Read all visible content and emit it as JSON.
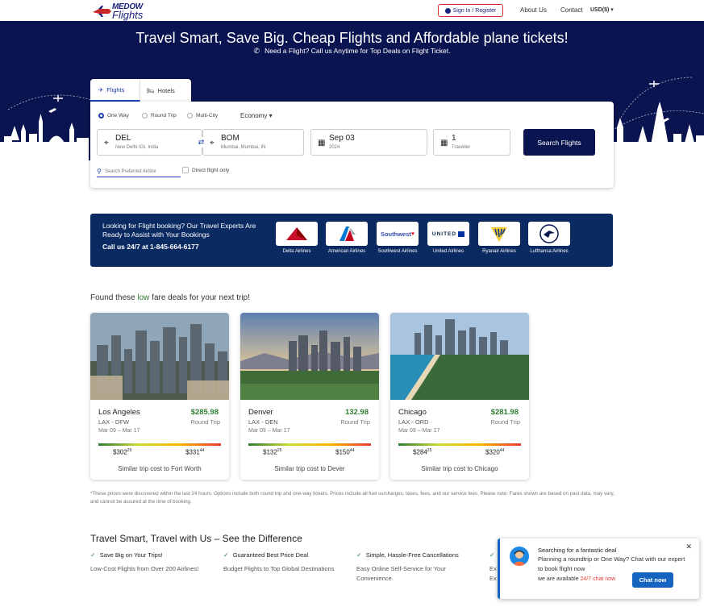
{
  "header": {
    "logo_top": "MEDOW",
    "logo_bottom": "Flights",
    "signin_label": "Sign In / Register",
    "about_label": "About Us",
    "contact_label": "Contact",
    "currency_label": "USD($) ▾"
  },
  "hero": {
    "title": "Travel Smart, Save Big. Cheap Flights and Affordable plane tickets!",
    "subtitle": "Need a Flight? Call us Anytime for Top Deals on Flight Ticket."
  },
  "search": {
    "tabs": [
      {
        "label": "Flights"
      },
      {
        "label": "Hotels"
      }
    ],
    "trip_types": [
      {
        "label": "One Way",
        "selected": true
      },
      {
        "label": "Round Trip",
        "selected": false
      },
      {
        "label": "Multi-City",
        "selected": false
      }
    ],
    "cabin_label": "Economy ▾",
    "from": {
      "code": "DEL",
      "detail": "New Delhi IGI, India"
    },
    "to": {
      "code": "BOM",
      "detail": "Mumbai, Mumbai, IN"
    },
    "date": {
      "value": "Sep 03",
      "year": "2024"
    },
    "travellers": {
      "count": "1",
      "label": "Traveller"
    },
    "search_label": "Search Flights",
    "airline_placeholder": "Search Preferred Airline",
    "direct_label": "Direct flight only"
  },
  "banner": {
    "text": "Looking for Flight booking? Our Travel Experts Are Ready to Assist with Your Bookings",
    "phone": "Call us 24/7 at 1-845-664-6177",
    "airlines": [
      {
        "name": "Delta Airlines"
      },
      {
        "name": "American Airlines"
      },
      {
        "name": "Southwest Airlines",
        "logo_text": "Southwest"
      },
      {
        "name": "United Airlines",
        "logo_text": "UNITED"
      },
      {
        "name": "Ryanair Airlines"
      },
      {
        "name": "Lufthansa Airlines"
      }
    ]
  },
  "deals": {
    "heading_pre": "Found these ",
    "heading_accent": "low",
    "heading_post": " fare deals for your next trip!",
    "items": [
      {
        "city": "Los Angeles",
        "price": "$285.98",
        "route": "LAX - DFW",
        "trip": "Round Trip",
        "dates": "Mar 09 – Mar 17",
        "low": "$302",
        "low_cents": "25",
        "high": "$331",
        "high_cents": "44",
        "footer": "Similar trip cost to Fort Worth"
      },
      {
        "city": "Denver",
        "price": "132.98",
        "route": "LAX - DEN",
        "trip": "Round Trip",
        "dates": "Mar 09 – Mar 17",
        "low": "$132",
        "low_cents": "25",
        "high": "$150",
        "high_cents": "44",
        "footer": "Similar trip cost to Dever"
      },
      {
        "city": "Chicago",
        "price": "$281.98",
        "route": "LAX - ORD",
        "trip": "Round Trip",
        "dates": "Mar 09 – Mar 17",
        "low": "$284",
        "low_cents": "25",
        "high": "$320",
        "high_cents": "44",
        "footer": "Similar trip cost to Chicago"
      }
    ],
    "disclaimer": "*These prices were discovered within the last 24 hours. Options include both round trip and one-way tickets. Prices include all fuel surcharges, taxes, fees, and our service fees. Please note: Fares shown are based on past data, may vary, and cannot be assured at the time of booking."
  },
  "features": {
    "title": "Travel Smart, Travel with Us – See the Difference",
    "items": [
      {
        "title": "Save Big on Your Trips!",
        "desc": "Low-Cost Flights from Over 200 Airlines!"
      },
      {
        "title": "Guaranteed Best Price Deal",
        "desc": "Budget Flights to Top Global Destinations"
      },
      {
        "title": "Simple, Hassle-Free Cancellations",
        "desc": "Easy Online Self-Service for Your Convenience."
      },
      {
        "title": "",
        "desc": "Ex Ex"
      }
    ]
  },
  "chat": {
    "title": "Searching for a fantastic deal",
    "message": "Planning a roundtrip or One Way? Chat with our expert to book flight now",
    "avail_pre": "we are available ",
    "avail_accent": "24/7 chat now",
    "button": "Chat now"
  },
  "colors": {
    "navy": "#0a1450",
    "banner": "#0a2a62",
    "accent_green": "#2e7d32",
    "chat_blue": "#1565c0"
  }
}
